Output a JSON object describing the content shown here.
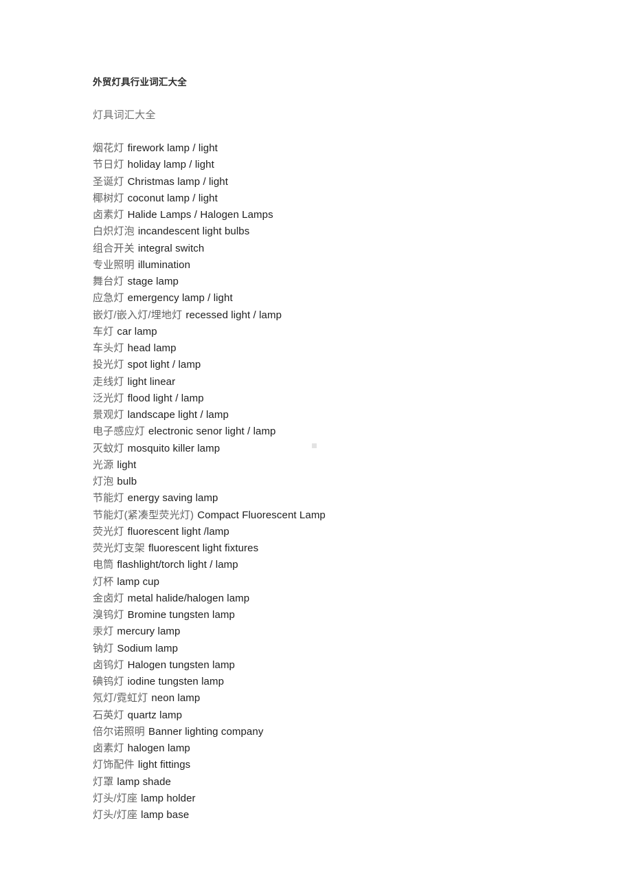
{
  "document": {
    "title": "外贸灯具行业词汇大全",
    "subtitle": "灯具词汇大全",
    "glossary": [
      {
        "zh": "烟花灯",
        "en": "firework lamp / light"
      },
      {
        "zh": "节日灯",
        "en": "holiday lamp / light"
      },
      {
        "zh": "圣诞灯",
        "en": "Christmas lamp / light"
      },
      {
        "zh": "椰树灯",
        "en": "coconut lamp / light"
      },
      {
        "zh": "卤素灯",
        "en": "Halide Lamps / Halogen Lamps"
      },
      {
        "zh": "白炽灯泡",
        "en": "incandescent light bulbs"
      },
      {
        "zh": "组合开关",
        "en": "integral switch"
      },
      {
        "zh": "专业照明",
        "en": "illumination"
      },
      {
        "zh": "舞台灯",
        "en": "stage lamp"
      },
      {
        "zh": "应急灯",
        "en": "emergency lamp / light"
      },
      {
        "zh": "嵌灯/嵌入灯/埋地灯",
        "en": "recessed light / lamp"
      },
      {
        "zh": "车灯",
        "en": "car lamp"
      },
      {
        "zh": "车头灯",
        "en": "head lamp"
      },
      {
        "zh": "投光灯",
        "en": "spot light / lamp"
      },
      {
        "zh": "走线灯",
        "en": "light linear"
      },
      {
        "zh": "泛光灯",
        "en": "flood light / lamp"
      },
      {
        "zh": "景观灯",
        "en": "landscape light / lamp"
      },
      {
        "zh": "电子感应灯",
        "en": "electronic senor light / lamp"
      },
      {
        "zh": "灭蚊灯",
        "en": "mosquito killer lamp"
      },
      {
        "zh": "光源",
        "en": "light"
      },
      {
        "zh": "灯泡",
        "en": "bulb"
      },
      {
        "zh": "节能灯",
        "en": "energy saving lamp"
      },
      {
        "zh": "节能灯(紧凑型荧光灯)",
        "en": "Compact Fluorescent Lamp"
      },
      {
        "zh": "荧光灯",
        "en": "fluorescent light /lamp"
      },
      {
        "zh": "荧光灯支架",
        "en": "fluorescent light fixtures"
      },
      {
        "zh": "电筒",
        "en": "flashlight/torch light / lamp"
      },
      {
        "zh": "灯杯",
        "en": "lamp cup"
      },
      {
        "zh": "金卤灯",
        "en": "metal halide/halogen lamp"
      },
      {
        "zh": "溴钨灯",
        "en": "Bromine tungsten lamp"
      },
      {
        "zh": "汞灯",
        "en": "mercury lamp"
      },
      {
        "zh": "钠灯",
        "en": "Sodium lamp"
      },
      {
        "zh": "卤钨灯",
        "en": "Halogen tungsten lamp"
      },
      {
        "zh": "碘钨灯",
        "en": "iodine tungsten lamp"
      },
      {
        "zh": "氖灯/霓虹灯",
        "en": "neon lamp"
      },
      {
        "zh": "石英灯",
        "en": "quartz lamp"
      },
      {
        "zh": "倍尔诺照明",
        "en": "Banner lighting company"
      },
      {
        "zh": "卤素灯",
        "en": "halogen lamp"
      },
      {
        "zh": "灯饰配件",
        "en": "light fittings"
      },
      {
        "zh": "灯罩",
        "en": "lamp shade"
      },
      {
        "zh": "灯头/灯座",
        "en": "lamp holder"
      },
      {
        "zh": "灯头/灯座",
        "en": "lamp base"
      }
    ]
  },
  "colors": {
    "page_background": "#ffffff",
    "title_text": "#2b2b2b",
    "subtitle_text": "#6e6e6e",
    "chinese_term_text": "#636363",
    "english_term_text": "#202020",
    "scan_artifact": "#e3e3e3"
  }
}
